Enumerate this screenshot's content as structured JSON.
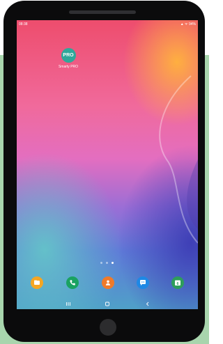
{
  "status_bar": {
    "time": "08:38",
    "right": "▲ ᯤ 94%"
  },
  "home_screen": {
    "app": {
      "icon_text": "PRO",
      "label": "Smarty PRO",
      "color": "#2fa89a"
    },
    "page_indicator": {
      "pages": 3,
      "active": 3
    }
  },
  "dock": [
    {
      "name": "my-files-icon",
      "color": "#f5a623"
    },
    {
      "name": "phone-icon",
      "color": "#1aa261"
    },
    {
      "name": "contacts-icon",
      "color": "#f07a2a"
    },
    {
      "name": "messages-icon",
      "color": "#1e88e5"
    },
    {
      "name": "calendar-icon",
      "color": "#2e9d5b",
      "text": "6"
    }
  ],
  "nav_bar": {
    "recents": "recents-icon",
    "home": "home-icon",
    "back": "back-icon"
  },
  "colors": {
    "frame": "#0b0b0c",
    "backdrop": "#a8d5ad"
  }
}
